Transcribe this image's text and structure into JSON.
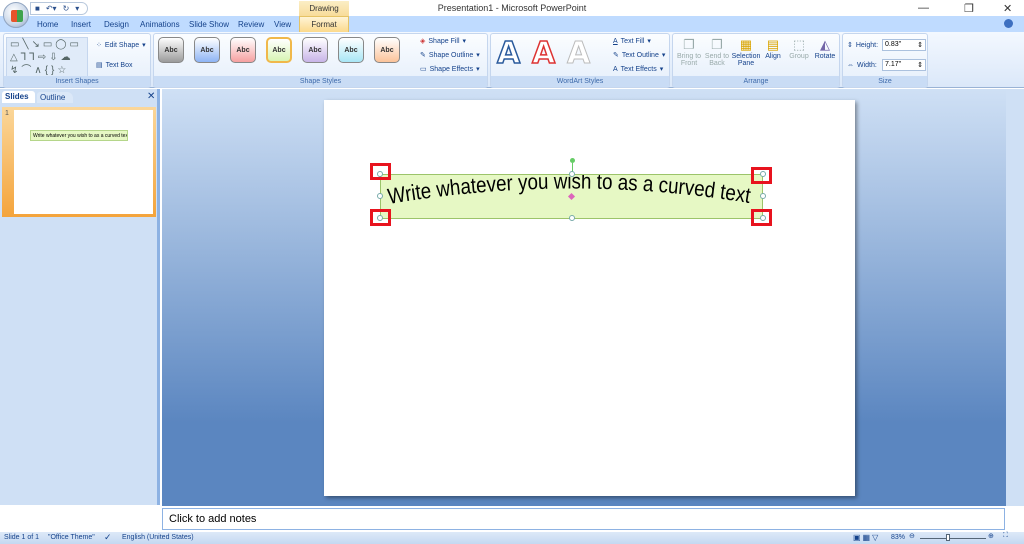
{
  "window": {
    "title": "Presentation1 - Microsoft PowerPoint",
    "contextual_tab_group": "Drawing Tools"
  },
  "tabs": [
    "Home",
    "Insert",
    "Design",
    "Animations",
    "Slide Show",
    "Review",
    "View",
    "Format"
  ],
  "ribbon": {
    "insert_shapes": {
      "label": "Insert Shapes",
      "edit_shape": "Edit Shape",
      "text_box": "Text Box"
    },
    "shape_styles": {
      "label": "Shape Styles",
      "swatch_text": "Abc",
      "swatches": [
        "#9b9b9b",
        "#8eb4f5",
        "#f6a0a0",
        "#d8f5b4",
        "#c8b4e8",
        "#a8e6f5",
        "#fbc39a"
      ],
      "selected_index": 3,
      "shape_fill": "Shape Fill",
      "shape_outline": "Shape Outline",
      "shape_effects": "Shape Effects"
    },
    "wordart_styles": {
      "label": "WordArt Styles",
      "letter": "A",
      "text_fill": "Text Fill",
      "text_outline": "Text Outline",
      "text_effects": "Text Effects"
    },
    "arrange": {
      "label": "Arrange",
      "bring_to_front": [
        "Bring to",
        "Front"
      ],
      "send_to_back": [
        "Send to",
        "Back"
      ],
      "selection_pane": [
        "Selection",
        "Pane"
      ],
      "align": "Align",
      "group": "Group",
      "rotate": "Rotate"
    },
    "size": {
      "label": "Size",
      "height_label": "Height:",
      "height_value": "0.83\"",
      "width_label": "Width:",
      "width_value": "7.17\""
    }
  },
  "left_pane": {
    "tabs": [
      "Slides",
      "Outline"
    ],
    "slide_number": "1"
  },
  "slide": {
    "text": "Write whatever you wish to as a curved text",
    "fill": "#e6f8c4"
  },
  "notes": {
    "placeholder": "Click to add notes"
  },
  "status": {
    "slide": "Slide 1 of 1",
    "theme": "\"Office Theme\"",
    "language": "English (United States)",
    "zoom": "83%"
  }
}
